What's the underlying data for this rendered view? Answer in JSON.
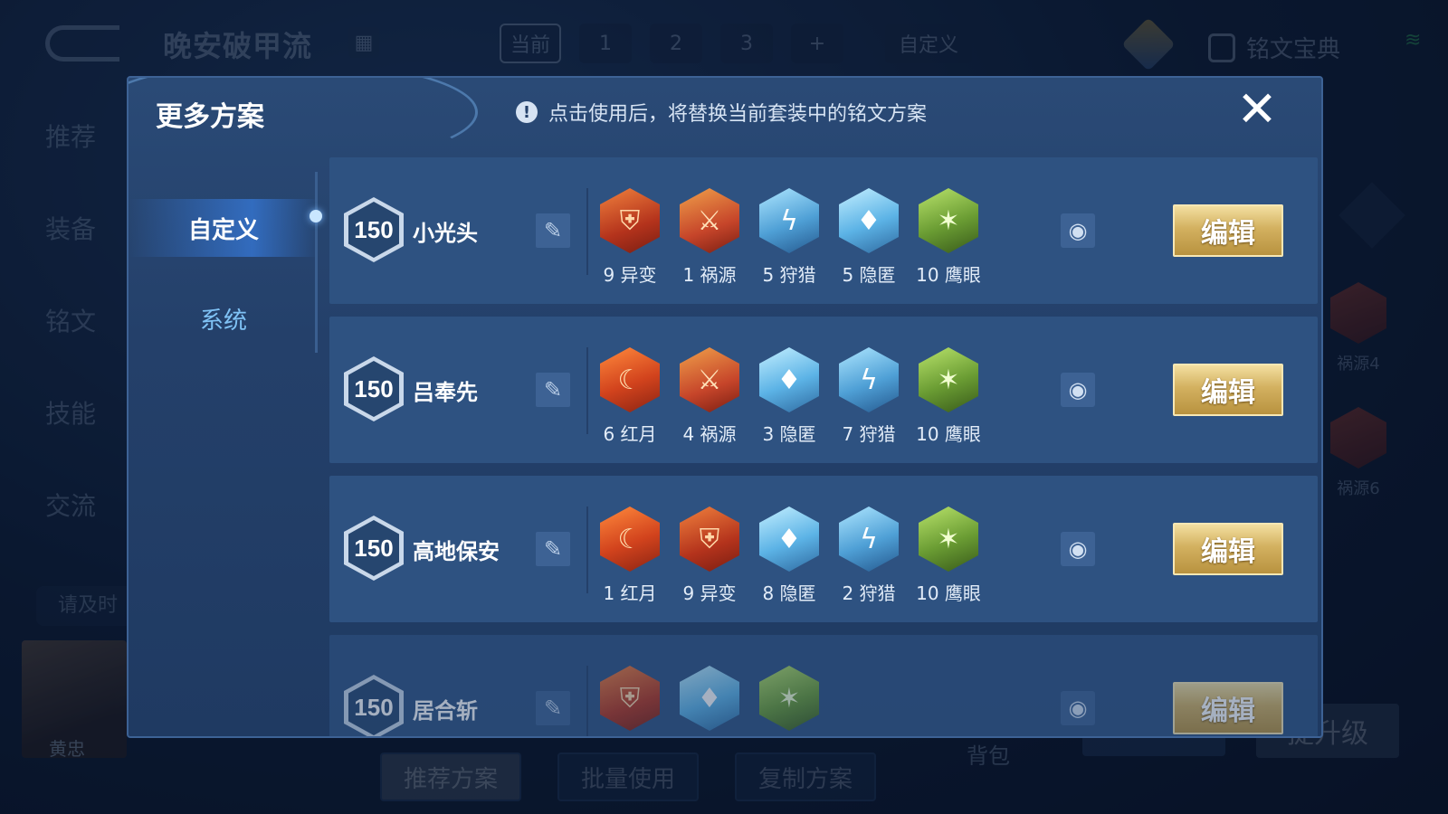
{
  "background": {
    "app_title": "晚安破甲流",
    "top_tabs": [
      {
        "label": "当前",
        "active": true
      },
      {
        "label": "1"
      },
      {
        "label": "2"
      },
      {
        "label": "3"
      },
      {
        "label": "+"
      },
      {
        "label": "自定义"
      }
    ],
    "codex_label": "铭文宝典",
    "left_nav": [
      "推荐",
      "装备",
      "铭文",
      "技能",
      "交流"
    ],
    "hint_text": "请及时",
    "hero_name": "黄忠",
    "bottom_buttons": [
      "推荐方案",
      "批量使用",
      "复制方案"
    ],
    "bag_label": "背包",
    "upgrade_label": "提升级",
    "side_runes": [
      "祸源4",
      "祸源6"
    ]
  },
  "modal": {
    "title": "更多方案",
    "notice": "点击使用后，将替换当前套装中的铭文方案",
    "close_icon": "close-icon",
    "tabs": [
      {
        "label": "自定义",
        "active": true
      },
      {
        "label": "系统",
        "active": false
      }
    ],
    "edit_label": "编辑",
    "plans": [
      {
        "level": "150",
        "name": "小光头",
        "runes": [
          {
            "count": "9",
            "name": "异变",
            "style": "red-a",
            "glyph": "⛨"
          },
          {
            "count": "1",
            "name": "祸源",
            "style": "red-b",
            "glyph": "⚔"
          },
          {
            "count": "5",
            "name": "狩猎",
            "style": "blue-a",
            "glyph": "ϟ"
          },
          {
            "count": "5",
            "name": "隐匿",
            "style": "blue-b",
            "glyph": "♦"
          },
          {
            "count": "10",
            "name": "鹰眼",
            "style": "green",
            "glyph": "✶"
          }
        ]
      },
      {
        "level": "150",
        "name": "吕奉先",
        "runes": [
          {
            "count": "6",
            "name": "红月",
            "style": "red-c",
            "glyph": "☾"
          },
          {
            "count": "4",
            "name": "祸源",
            "style": "red-b",
            "glyph": "⚔"
          },
          {
            "count": "3",
            "name": "隐匿",
            "style": "blue-b",
            "glyph": "♦"
          },
          {
            "count": "7",
            "name": "狩猎",
            "style": "blue-a",
            "glyph": "ϟ"
          },
          {
            "count": "10",
            "name": "鹰眼",
            "style": "green",
            "glyph": "✶"
          }
        ]
      },
      {
        "level": "150",
        "name": "高地保安",
        "runes": [
          {
            "count": "1",
            "name": "红月",
            "style": "red-c",
            "glyph": "☾"
          },
          {
            "count": "9",
            "name": "异变",
            "style": "red-a",
            "glyph": "⛨"
          },
          {
            "count": "8",
            "name": "隐匿",
            "style": "blue-b",
            "glyph": "♦"
          },
          {
            "count": "2",
            "name": "狩猎",
            "style": "blue-a",
            "glyph": "ϟ"
          },
          {
            "count": "10",
            "name": "鹰眼",
            "style": "green",
            "glyph": "✶"
          }
        ]
      },
      {
        "level": "150",
        "name": "居合斩",
        "partial": true,
        "runes": [
          {
            "count": "",
            "name": "",
            "style": "red-a",
            "glyph": "⛨"
          },
          {
            "count": "",
            "name": "",
            "style": "blue-b",
            "glyph": "♦"
          },
          {
            "count": "",
            "name": "",
            "style": "green",
            "glyph": "✶"
          }
        ]
      }
    ]
  }
}
